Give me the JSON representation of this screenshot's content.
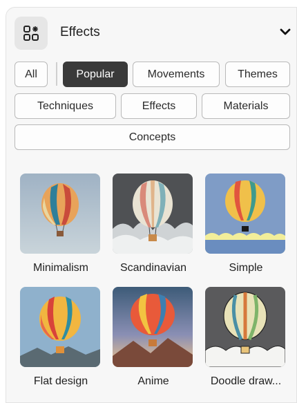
{
  "header": {
    "title": "Effects",
    "icon": "effects-grid-icon",
    "collapse_icon": "chevron-down-icon"
  },
  "filters": {
    "all": "All",
    "popular": "Popular",
    "movements": "Movements",
    "themes": "Themes",
    "techniques": "Techniques",
    "effects": "Effects",
    "materials": "Materials",
    "concepts": "Concepts",
    "active": "Popular"
  },
  "styles": [
    {
      "label": "Minimalism"
    },
    {
      "label": "Scandinavian"
    },
    {
      "label": "Simple"
    },
    {
      "label": "Flat design"
    },
    {
      "label": "Anime"
    },
    {
      "label": "Doodle draw..."
    }
  ],
  "colors": {
    "active_chip": "#3a3a3a",
    "chip_border": "#b9b9b9",
    "panel_bg": "#f7f7f7"
  }
}
